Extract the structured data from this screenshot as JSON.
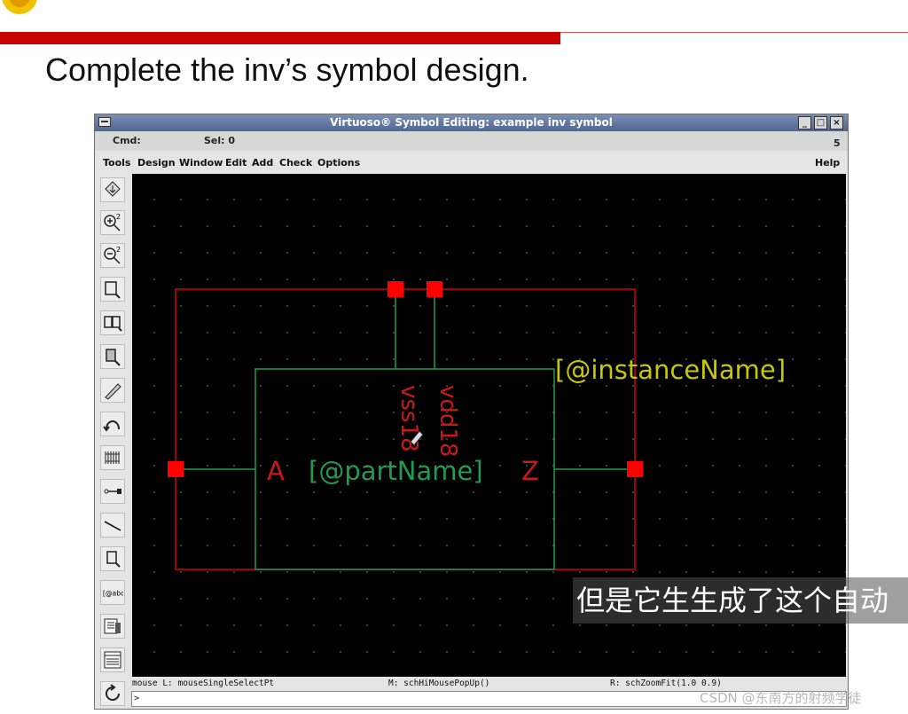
{
  "slide": {
    "title": "Complete the inv’s symbol design."
  },
  "window": {
    "title": "Virtuoso® Symbol Editing: example inv symbol",
    "buttons": {
      "minimize": "_",
      "maximize": "□",
      "close": "×"
    }
  },
  "status": {
    "cmd_label": "Cmd:",
    "sel_label": "Sel: 0",
    "count": "5"
  },
  "menu": {
    "items": [
      "Tools",
      "Design",
      "Window",
      "Edit",
      "Add",
      "Check",
      "Options"
    ],
    "help": "Help"
  },
  "toolbar": {
    "tools": [
      "save-tool-icon",
      "zoom-in-icon",
      "zoom-out-icon",
      "stretch-icon",
      "copy-icon",
      "move-icon",
      "wire-edit-icon",
      "undo-icon",
      "pins-icon",
      "add-pin-icon",
      "add-line-icon",
      "add-shape-icon",
      "add-label-icon",
      "check-icon",
      "properties-icon",
      "redraw-icon"
    ],
    "label_tool_text": "[@abc]",
    "zoom_factor": "2"
  },
  "symbol": {
    "instance_name_label": "[@instanceName]",
    "part_name_label": "[@partName]",
    "pin_a": "A",
    "pin_z": "Z",
    "pin_vss": "vss18",
    "pin_vdd": "vdd18",
    "colors": {
      "selection_box": "#d40000",
      "body": "#1f9c4f",
      "pin_label": "#c81818",
      "instance_label": "#c8c800",
      "part_label": "#1f9c4f",
      "pin_marker": "#ff0000"
    }
  },
  "mouse_bar": {
    "left": "mouse L: mouseSingleSelectPt",
    "middle": "M: schHiMousePopUp()",
    "right": "R: schZoomFit(1.0 0.9)"
  },
  "prompt": ">",
  "subtitle": "但是它生生成了这个自动",
  "watermark": "CSDN @东南方的射频学徒"
}
